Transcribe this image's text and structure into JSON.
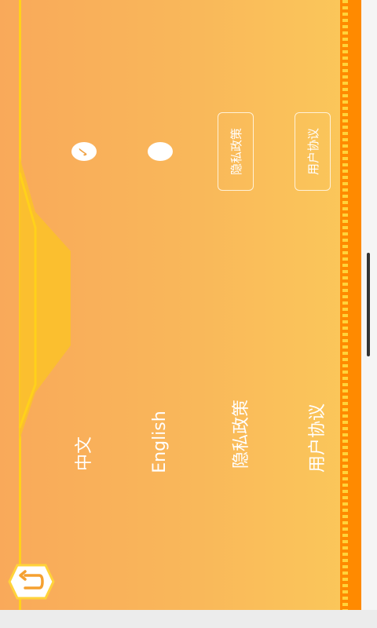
{
  "settings": {
    "languages": [
      {
        "label": "中文",
        "selected": true
      },
      {
        "label": "English",
        "selected": false
      }
    ],
    "privacy_label": "隐私政策",
    "user_agreement_label": "用户协议",
    "privacy_button": "隐私政策",
    "user_agreement_button": "用户协议"
  },
  "icons": {
    "check": "check-icon",
    "back": "back-arrow-icon"
  },
  "colors": {
    "panel_start": "#f9a95a",
    "panel_end": "#fbc85a",
    "accent_strip": "#ff8a00",
    "dash": "#ffd33a",
    "text": "#ffffff"
  }
}
